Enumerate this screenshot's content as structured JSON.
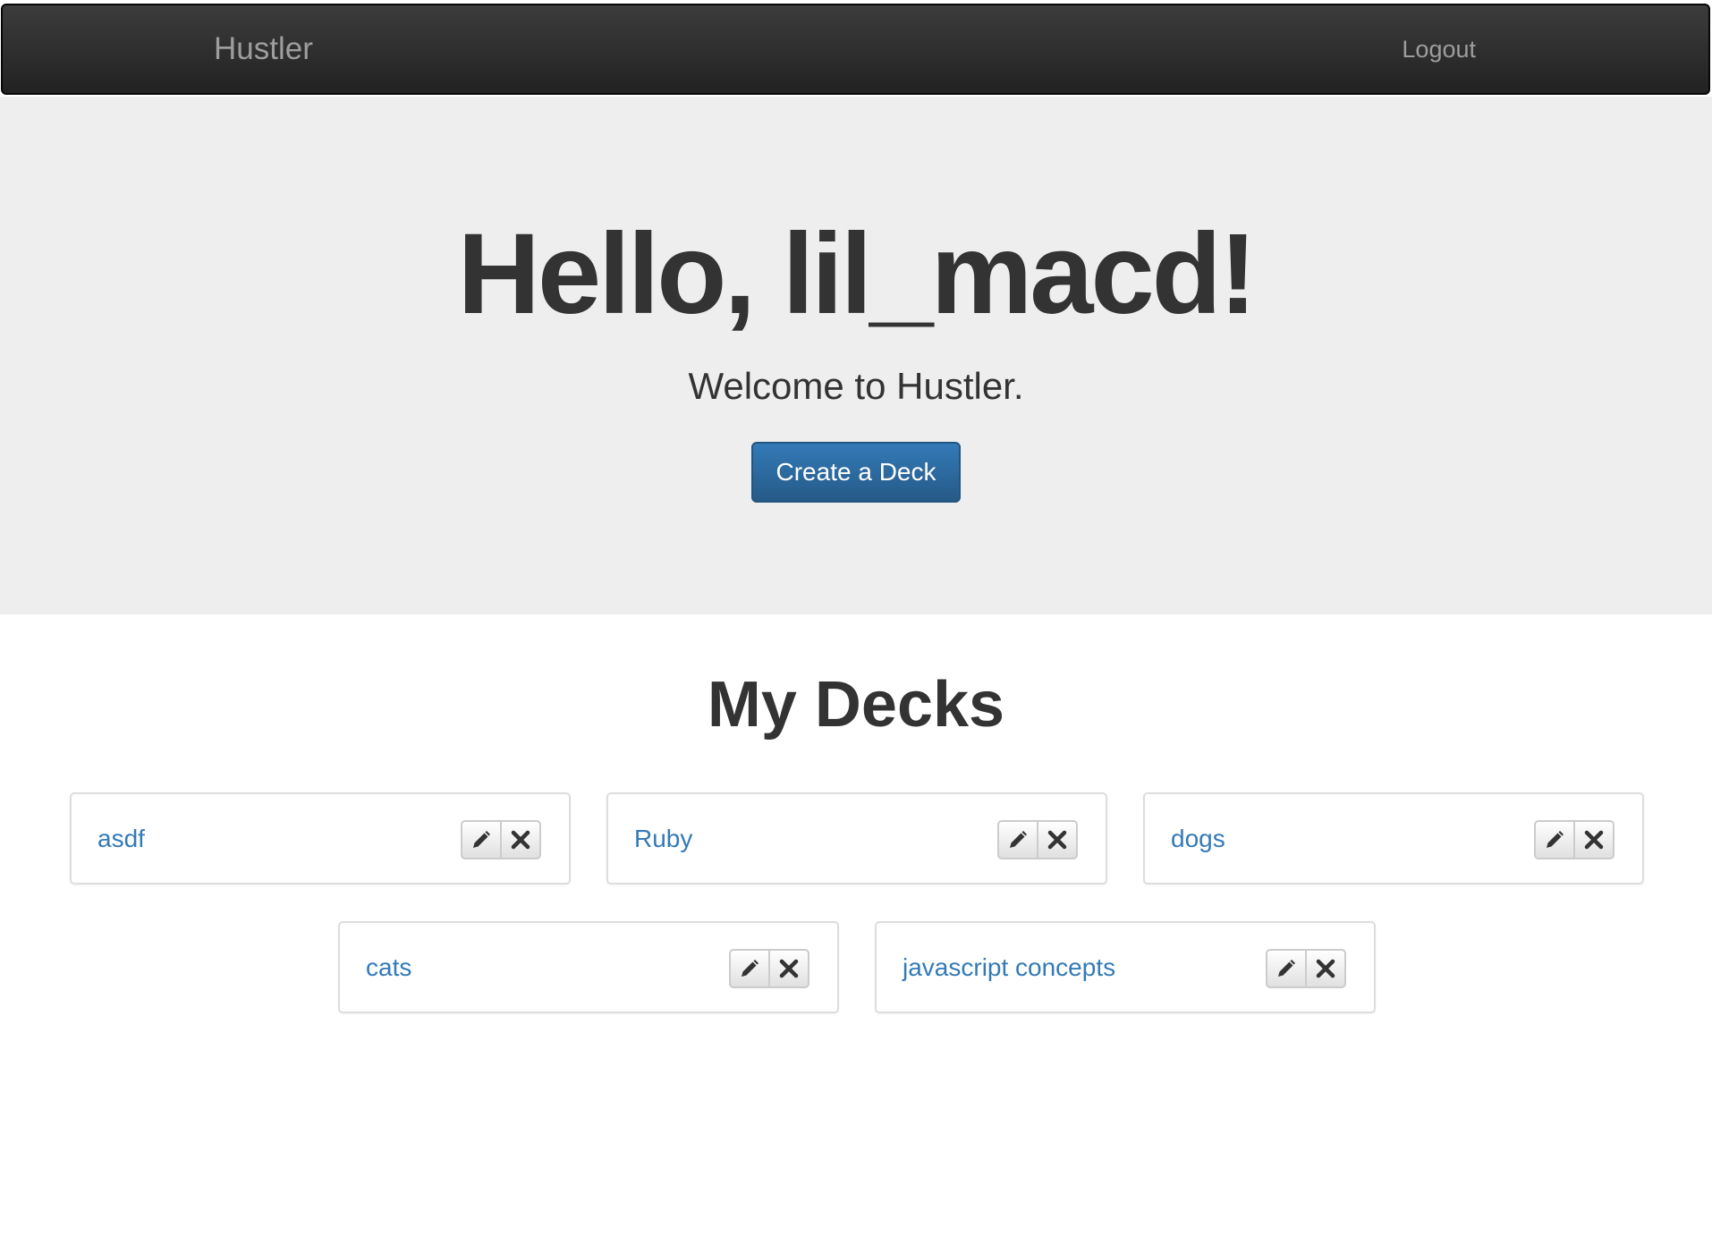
{
  "navbar": {
    "brand": "Hustler",
    "logout_label": "Logout",
    "bg_color": "#222222"
  },
  "jumbotron": {
    "greeting": "Hello, lil_macd!",
    "welcome": "Welcome to Hustler.",
    "create_button_label": "Create a Deck",
    "bg_color": "#eeeeee"
  },
  "decks_section": {
    "title": "My Decks",
    "decks": [
      {
        "name": "asdf"
      },
      {
        "name": "Ruby"
      },
      {
        "name": "dogs"
      },
      {
        "name": "cats"
      },
      {
        "name": "javascript concepts"
      }
    ],
    "actions": {
      "edit_icon": "pencil-icon",
      "delete_icon": "close-icon"
    }
  },
  "colors": {
    "link": "#337ab7",
    "primary_button": "#337ab7",
    "text": "#333333"
  }
}
